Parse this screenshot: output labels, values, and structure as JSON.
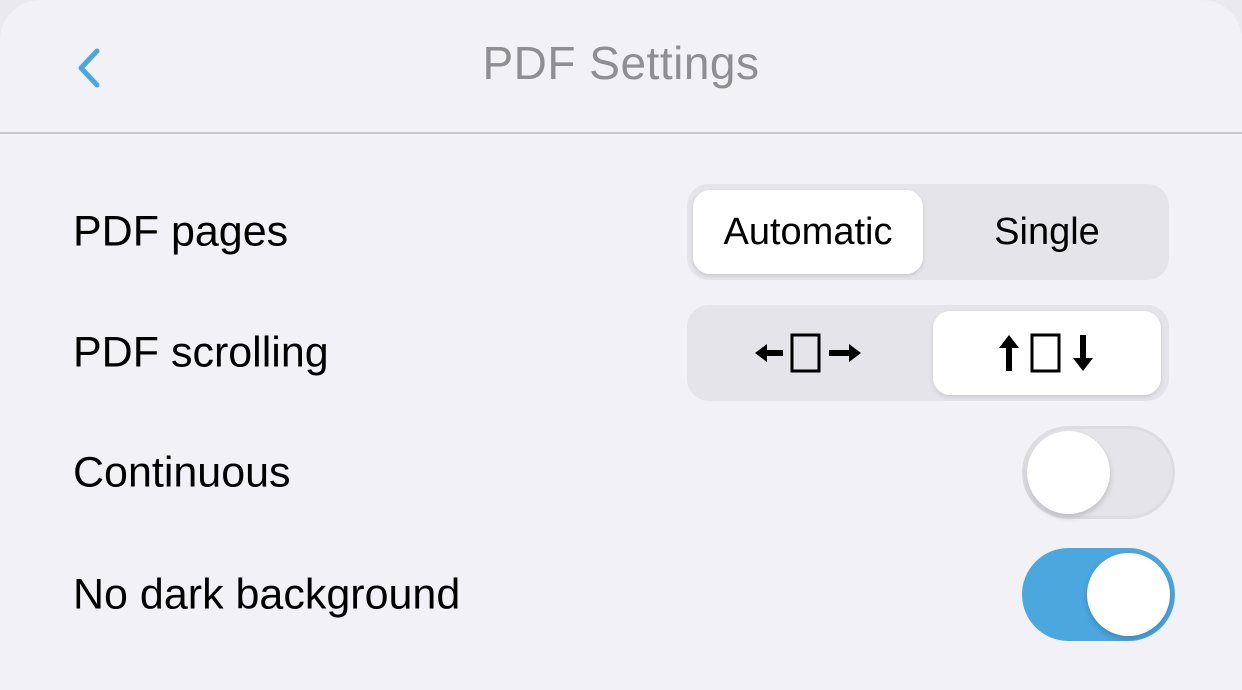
{
  "navbar": {
    "title": "PDF Settings",
    "back_icon": "chevron-left-icon"
  },
  "colors": {
    "accent": "#4ba7de",
    "background": "#f1f1f6",
    "segment_track": "#e4e4e9",
    "title_gray": "#8e8e93"
  },
  "settings": {
    "pdf_pages": {
      "label": "PDF pages",
      "options": [
        "Automatic",
        "Single"
      ],
      "selected": "Automatic"
    },
    "pdf_scrolling": {
      "label": "PDF scrolling",
      "options": [
        "horizontal-scroll-icon",
        "vertical-scroll-icon"
      ],
      "selected": "vertical-scroll-icon"
    },
    "continuous": {
      "label": "Continuous",
      "on": false
    },
    "no_dark_background": {
      "label": "No dark background",
      "on": true
    }
  }
}
